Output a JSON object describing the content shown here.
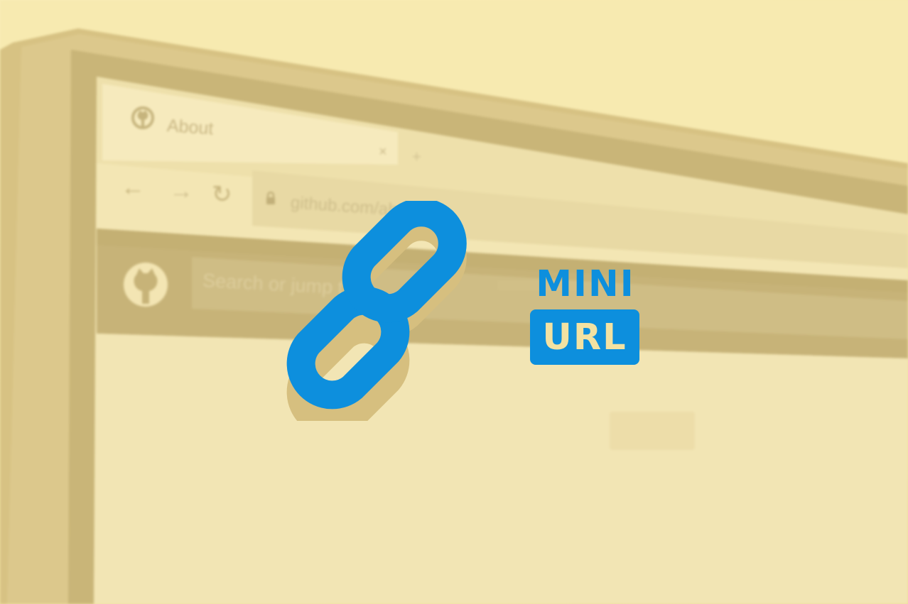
{
  "browser": {
    "tab_title": "About",
    "tab_close_glyph": "×",
    "new_tab_glyph": "+",
    "back_glyph": "←",
    "forward_glyph": "→",
    "reload_glyph": "↻",
    "address_text": "github.com/ab",
    "search_placeholder": "Search or jump t",
    "tab_icon": "github-icon",
    "header_icon": "github-icon"
  },
  "logo": {
    "icon": "chain-link-icon",
    "word_top": "MINI",
    "word_bottom": "URL",
    "brand_color": "#0d8fdd",
    "shadow_color": "#d6bf7f",
    "background_color": "#f6e7a8"
  }
}
